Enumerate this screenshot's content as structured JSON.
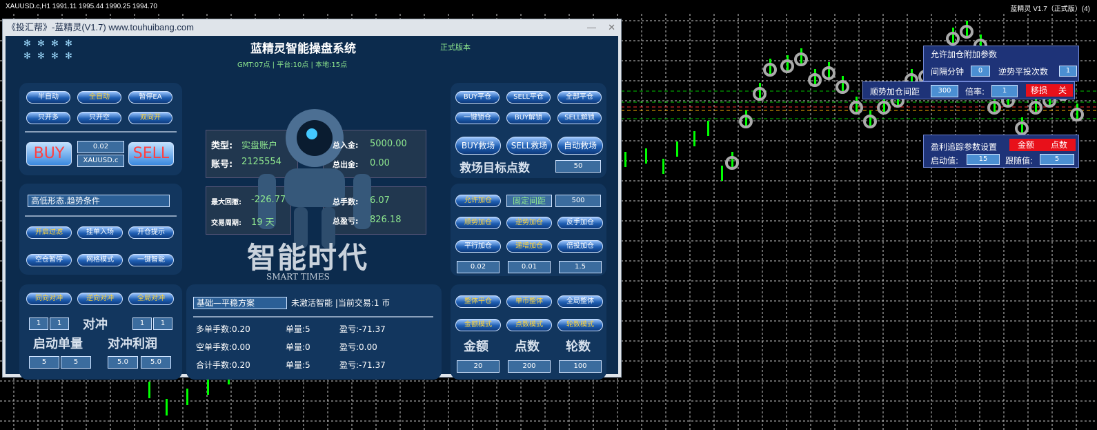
{
  "topbar": {
    "symbol_info": "XAUUSD.c,H1  1991.11 1995.44 1990.25 1994.70",
    "right_info": "蓝精灵 V1.7（正式版）(4)"
  },
  "window": {
    "title": "《投汇帮》-蓝精灵(V1.7) www.touhuibang.com",
    "min_label": "—",
    "close_label": "✕"
  },
  "header": {
    "title": "蓝精灵智能操盘系统",
    "version": "正式版本",
    "times": "GMT:07点  |  平台:10点  |  本地:15点",
    "stars": [
      "✻",
      "✻",
      "✻",
      "✻",
      "✻",
      "✻",
      "✻",
      "✻"
    ]
  },
  "left": {
    "mode_buttons": [
      "半自动",
      "全自动",
      "暂停EA",
      "只开多",
      "只开空",
      "双向开"
    ],
    "buy": "BUY",
    "sell": "SELL",
    "lot": "0.02",
    "symbol": "XAUUSD.c",
    "condition": "高低形态.趋势条件",
    "filter_buttons": [
      "开启过滤",
      "挂单入场",
      "开仓提示",
      "空仓暂停",
      "网格模式",
      "一键智能"
    ],
    "hedge_buttons": [
      "同向对冲",
      "逆向对冲",
      "全局对冲"
    ],
    "hedge_label": "对冲",
    "start_label": "启动单量",
    "profit_label": "对冲利润",
    "hedge_vals": [
      "1",
      "1",
      "1",
      "1"
    ],
    "start_vals": [
      "5",
      "5"
    ],
    "profit_vals": [
      "5.0",
      "5.0"
    ]
  },
  "center": {
    "type_label": "类型:",
    "type_val": "实盘账户",
    "acct_label": "账号:",
    "acct_val": "2125554",
    "dep_label": "总入金:",
    "dep_val": "5000.00",
    "wd_label": "总出金:",
    "wd_val": "0.00",
    "dd_label": "最大回撤:",
    "dd_val": "-226.77",
    "period_label": "交易周期:",
    "period_val": "19 天",
    "lots_label": "总手数:",
    "lots_val": "6.07",
    "pl_label": "总盈亏:",
    "pl_val": "826.18",
    "logo_cn": "智能时代",
    "logo_en": "SMART TIMES",
    "plan": "基础—平稳方案",
    "plan_status": "未激活智能  |当前交易:1 币",
    "rows": [
      {
        "a": "多单手数:0.20",
        "b": "单量:5",
        "c": "盈亏:-71.37"
      },
      {
        "a": "空单手数:0.00",
        "b": "单量:0",
        "c": "盈亏:0.00"
      },
      {
        "a": "合计手数:0.20",
        "b": "单量:5",
        "c": "盈亏:-71.37"
      }
    ]
  },
  "right": {
    "close_buttons": [
      "BUY平仓",
      "SELL平仓",
      "全部平仓",
      "一键锁仓",
      "BUY解锁",
      "SELL解锁"
    ],
    "rescue_buttons": [
      "BUY救场",
      "SELL救场",
      "自动救场"
    ],
    "rescue_label": "救场目标点数",
    "rescue_val": "50",
    "add_buttons": [
      "允许加仓",
      "固定间距",
      "顺势加仓",
      "逆势加仓",
      "反手加仓",
      "平行加仓",
      "递增加仓",
      "倍投加仓"
    ],
    "add_val": "500",
    "add_vals": [
      "0.02",
      "0.01",
      "1.5"
    ],
    "whole_buttons": [
      "整体平仓",
      "单币整体",
      "全局整体",
      "金额模式",
      "点数模式",
      "轮数模式"
    ],
    "whole_labels": [
      "金额",
      "点数",
      "轮数"
    ],
    "whole_vals": [
      "20",
      "200",
      "100"
    ]
  },
  "overlays": {
    "extra_title": "允许加仓附加参数",
    "interval_label": "间隔分钟",
    "interval_val": "0",
    "counter_label": "逆势平投次数",
    "counter_val": "1",
    "trend_label": "顺势加仓间距",
    "trend_val": "300",
    "ratio_label": "倍率:",
    "ratio_val": "1",
    "move_label": "移损",
    "move_off": "关",
    "trail_title": "盈利追踪参数设置",
    "amount": "金额",
    "points": "点数",
    "start_label": "启动值:",
    "start_val": "15",
    "follow_label": "跟随值:",
    "follow_val": "5"
  },
  "colors": {
    "panel": "#12365e",
    "body": "#0c2b4d",
    "button": "#1f5fb3",
    "gold": "#ffd43a",
    "candle": "#00ff00",
    "overlay": "#1e3378",
    "red": "#e8101a"
  }
}
